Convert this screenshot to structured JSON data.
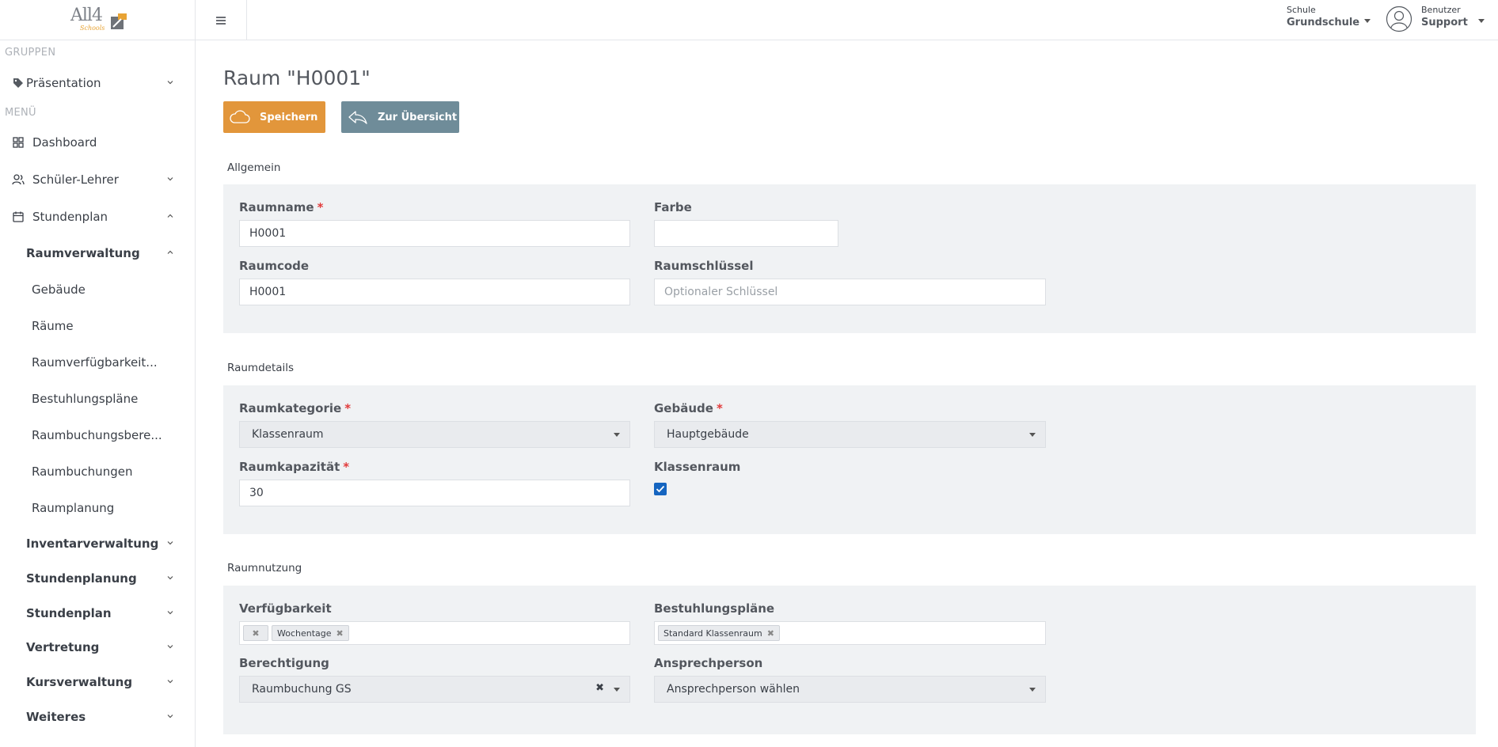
{
  "logo": {
    "main": "All4",
    "sub": "Schools"
  },
  "sidebar": {
    "groups_label": "GRUPPEN",
    "menu_label": "MENÜ",
    "items": [
      {
        "label": "Präsentation"
      },
      {
        "label": "Dashboard"
      },
      {
        "label": "Schüler-Lehrer"
      },
      {
        "label": "Stundenplan"
      },
      {
        "label": "Raumverwaltung"
      },
      {
        "label": "Gebäude"
      },
      {
        "label": "Räume"
      },
      {
        "label": "Raumverfügbarkeit..."
      },
      {
        "label": "Bestuhlungspläne"
      },
      {
        "label": "Raumbuchungsbere..."
      },
      {
        "label": "Raumbuchungen"
      },
      {
        "label": "Raumplanung"
      },
      {
        "label": "Inventarverwaltung"
      },
      {
        "label": "Stundenplanung"
      },
      {
        "label": "Stundenplan"
      },
      {
        "label": "Vertretung"
      },
      {
        "label": "Kursverwaltung"
      },
      {
        "label": "Weiteres"
      }
    ]
  },
  "topbar": {
    "school_label": "Schule",
    "school_value": "Grundschule",
    "user_label": "Benutzer",
    "user_value": "Support"
  },
  "page": {
    "title": "Raum \"H0001\"",
    "save_label": "Speichern",
    "overview_label": "Zur Übersicht"
  },
  "allgemein": {
    "title": "Allgemein",
    "raumname_label": "Raumname",
    "raumname_value": "H0001",
    "farbe_label": "Farbe",
    "raumcode_label": "Raumcode",
    "raumcode_value": "H0001",
    "raumschluessel_label": "Raumschlüssel",
    "raumschluessel_placeholder": "Optionaler Schlüssel"
  },
  "raumdetails": {
    "title": "Raumdetails",
    "kategorie_label": "Raumkategorie",
    "kategorie_value": "Klassenraum",
    "gebaeude_label": "Gebäude",
    "gebaeude_value": "Hauptgebäude",
    "kapazitaet_label": "Raumkapazität",
    "kapazitaet_value": "30",
    "klassenraum_label": "Klassenraum",
    "klassenraum_checked": true
  },
  "raumnutzung": {
    "title": "Raumnutzung",
    "verfuegbarkeit_label": "Verfügbarkeit",
    "verfuegbarkeit_tags": [
      "",
      "Wochentage"
    ],
    "bestuhlung_label": "Bestuhlungspläne",
    "bestuhlung_tags": [
      "Standard Klassenraum"
    ],
    "berechtigung_label": "Berechtigung",
    "berechtigung_value": "Raumbuchung GS",
    "ansprech_label": "Ansprechperson",
    "ansprech_value": "Ansprechperson wählen"
  },
  "colors": {
    "primary": "#e2963b",
    "secondary": "#6f8c99",
    "required": "#e23b3b",
    "checkbox": "#1565c0",
    "panel": "#f0f2f4"
  }
}
